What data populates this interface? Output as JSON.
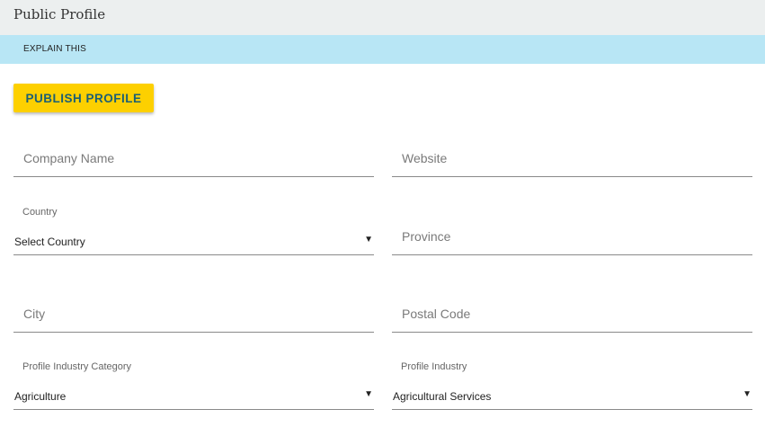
{
  "header": {
    "title": "Public Profile"
  },
  "explain": {
    "label": "EXPLAIN THIS"
  },
  "actions": {
    "publish_label": "PUBLISH PROFILE"
  },
  "form": {
    "company_name": {
      "placeholder": "Company Name",
      "value": ""
    },
    "website": {
      "placeholder": "Website",
      "value": ""
    },
    "country": {
      "label": "Country",
      "selected": "Select Country"
    },
    "province": {
      "placeholder": "Province",
      "value": ""
    },
    "city": {
      "placeholder": "City",
      "value": ""
    },
    "postal_code": {
      "placeholder": "Postal Code",
      "value": ""
    },
    "industry_category": {
      "label": "Profile Industry Category",
      "selected": "Agriculture"
    },
    "industry": {
      "label": "Profile Industry",
      "selected": "Agricultural Services"
    }
  },
  "icons": {
    "dropdown": "caret-down-icon"
  },
  "colors": {
    "header_bg": "#ecefef",
    "explain_bg": "#b8e6f5",
    "button_bg": "#fdd000",
    "button_text": "#1c5f73"
  }
}
